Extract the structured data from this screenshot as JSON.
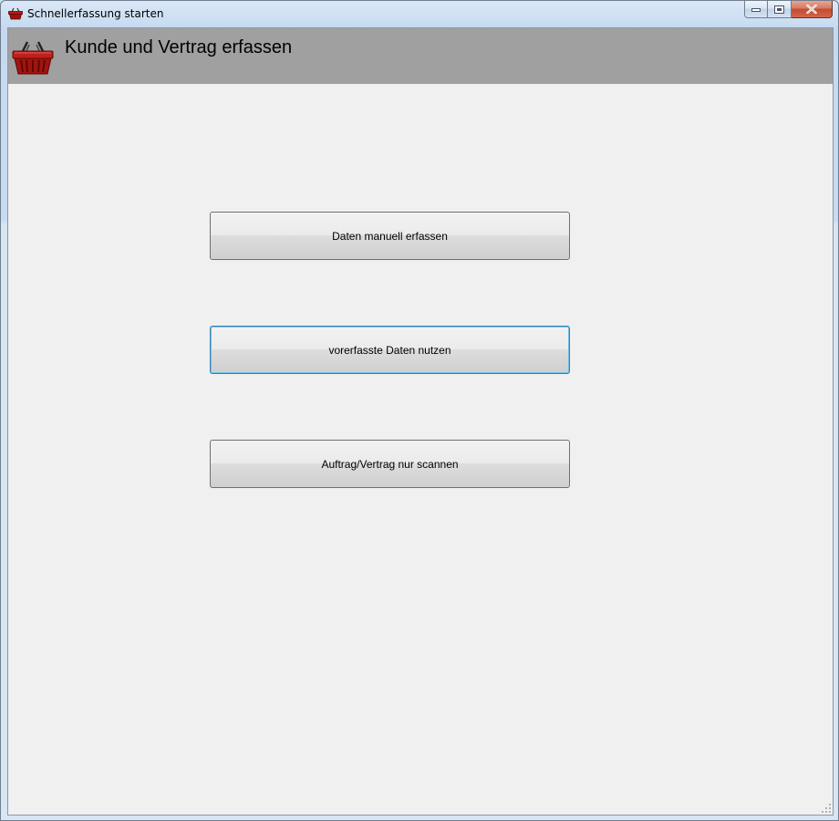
{
  "window": {
    "title": "Schnellerfassung starten",
    "icon": "basket-icon",
    "controls": [
      "minimize-icon",
      "maximize-icon",
      "close-icon"
    ]
  },
  "header": {
    "title": "Kunde und Vertrag erfassen",
    "icon": "basket-icon",
    "background": "#a0a0a0"
  },
  "actions": [
    {
      "label": "Daten manuell erfassen",
      "focused": false
    },
    {
      "label": "vorerfasste Daten nutzen",
      "focused": true
    },
    {
      "label": "Auftrag/Vertrag nur scannen",
      "focused": false
    }
  ],
  "colors": {
    "accent_focus": "#3c7fb1",
    "basket_red": "#c0201c",
    "close_red": "#c34a2f"
  }
}
